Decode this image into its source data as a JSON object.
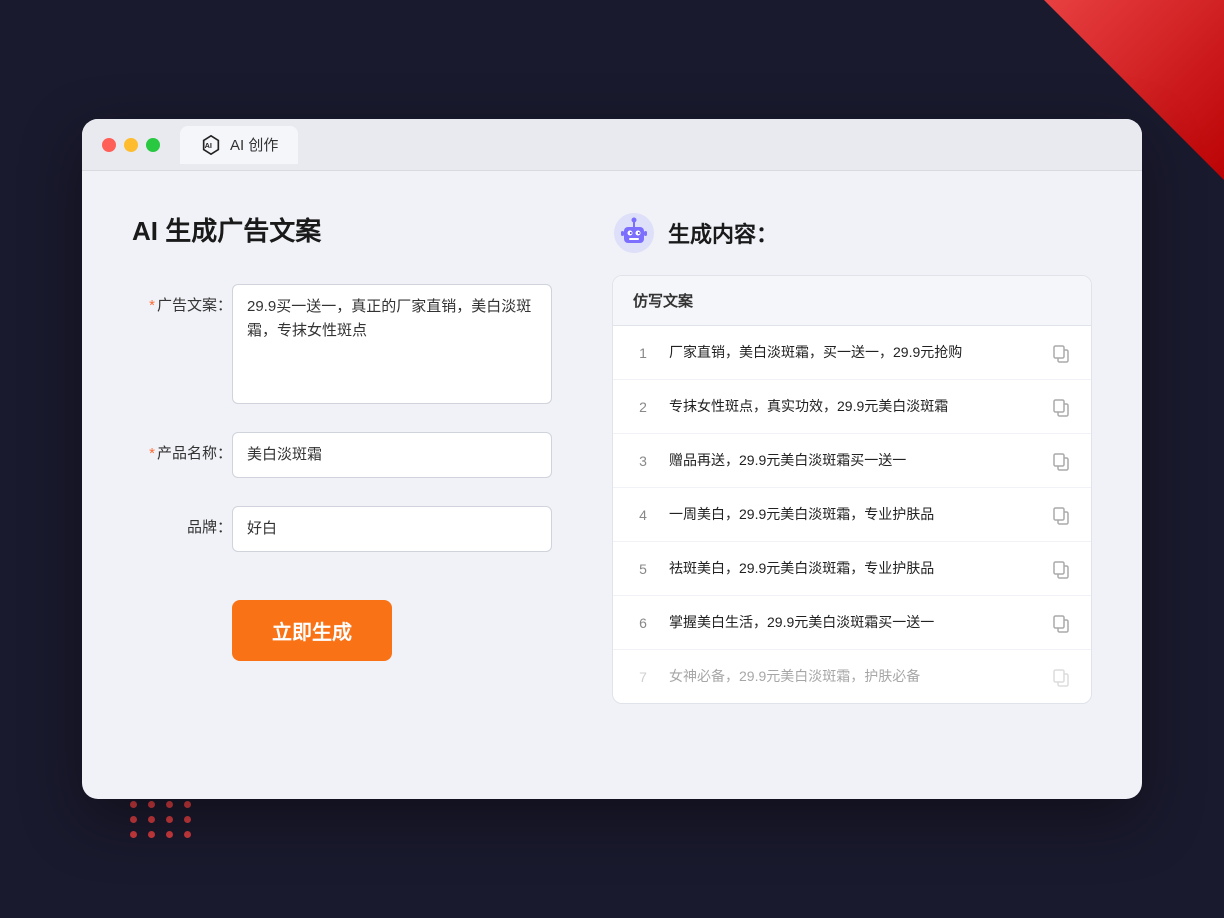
{
  "window": {
    "tab_label": "AI 创作"
  },
  "left_panel": {
    "title": "AI 生成广告文案",
    "fields": [
      {
        "label": "广告文案：",
        "required": true,
        "type": "textarea",
        "value": "29.9买一送一，真正的厂家直销，美白淡斑霜，专抹女性斑点",
        "name": "ad-copy-textarea"
      },
      {
        "label": "产品名称：",
        "required": true,
        "type": "input",
        "value": "美白淡斑霜",
        "name": "product-name-input"
      },
      {
        "label": "品牌：",
        "required": false,
        "type": "input",
        "value": "好白",
        "name": "brand-input"
      }
    ],
    "button_label": "立即生成"
  },
  "right_panel": {
    "title": "生成内容：",
    "table_header": "仿写文案",
    "results": [
      {
        "num": "1",
        "text": "厂家直销，美白淡斑霜，买一送一，29.9元抢购",
        "dimmed": false
      },
      {
        "num": "2",
        "text": "专抹女性斑点，真实功效，29.9元美白淡斑霜",
        "dimmed": false
      },
      {
        "num": "3",
        "text": "赠品再送，29.9元美白淡斑霜买一送一",
        "dimmed": false
      },
      {
        "num": "4",
        "text": "一周美白，29.9元美白淡斑霜，专业护肤品",
        "dimmed": false
      },
      {
        "num": "5",
        "text": "祛斑美白，29.9元美白淡斑霜，专业护肤品",
        "dimmed": false
      },
      {
        "num": "6",
        "text": "掌握美白生活，29.9元美白淡斑霜买一送一",
        "dimmed": false
      },
      {
        "num": "7",
        "text": "女神必备，29.9元美白淡斑霜，护肤必备",
        "dimmed": true
      }
    ]
  },
  "colors": {
    "orange": "#f97316",
    "blue": "#5b8ef0",
    "red": "#ff4444"
  }
}
